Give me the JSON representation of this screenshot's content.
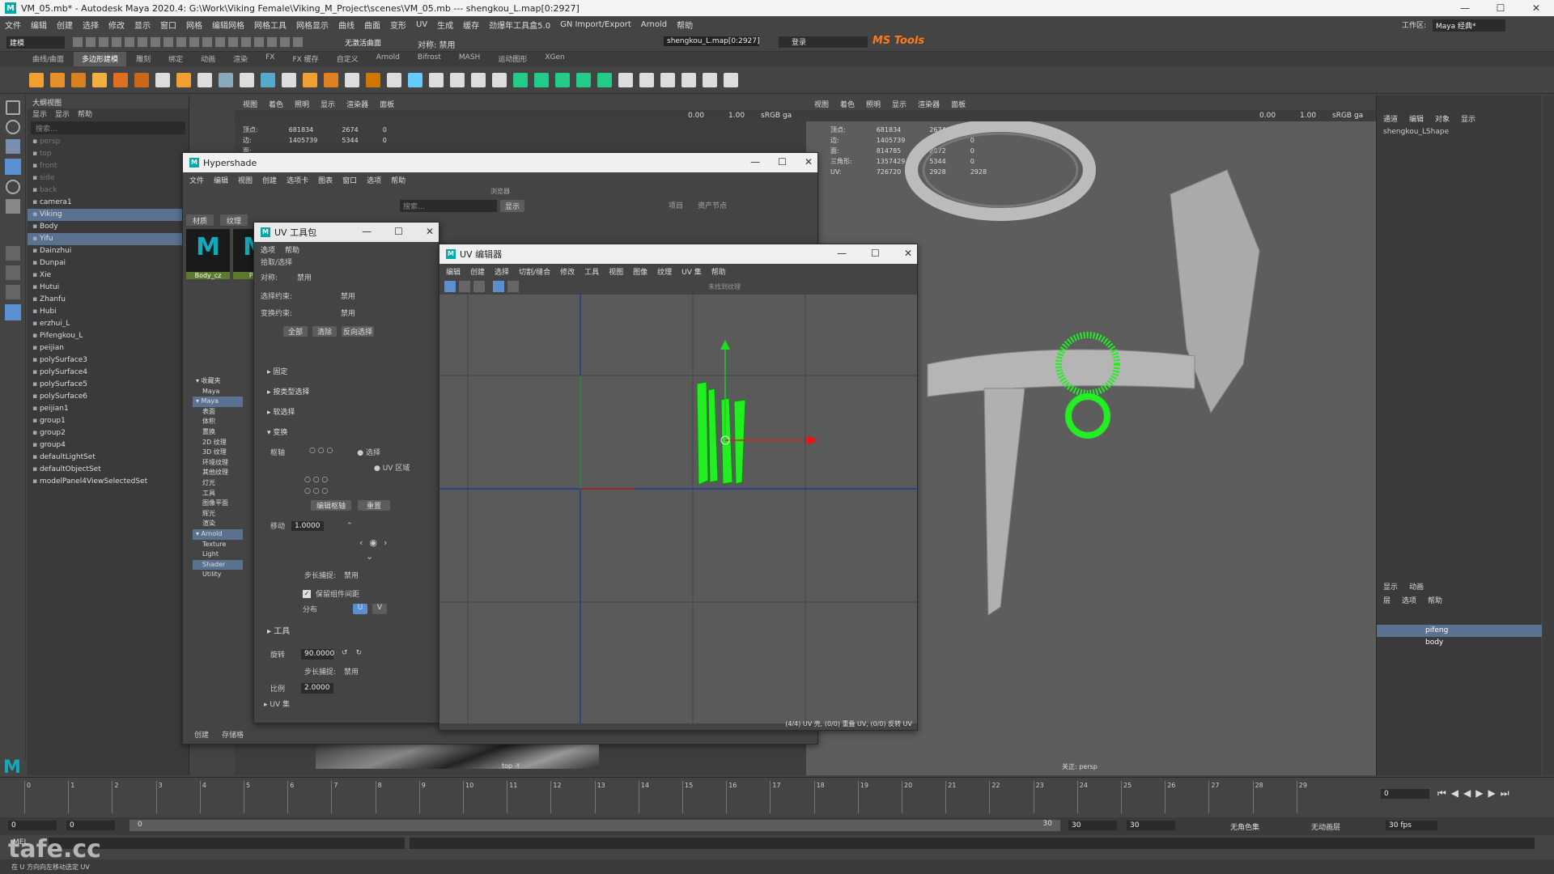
{
  "app": {
    "title": "VM_05.mb* - Autodesk Maya 2020.4: G:\\Work\\Viking Female\\Viking_M_Project\\scenes\\VM_05.mb  ---  shengkou_L.map[0:2927]",
    "workspace_label": "工作区:",
    "workspace_value": "Maya 经典*"
  },
  "menubar": [
    "文件",
    "编辑",
    "创建",
    "选择",
    "修改",
    "显示",
    "窗口",
    "网格",
    "编辑网格",
    "网格工具",
    "网格显示",
    "曲线",
    "曲面",
    "变形",
    "UV",
    "生成",
    "缓存",
    "劲爆年工具盒5.0",
    "GN Import/Export",
    "Arnold",
    "帮助"
  ],
  "toolbar": {
    "mode": "建模",
    "symmetry": "无激活曲面",
    "symmetry_label": "对称: 禁用",
    "selection_field": "shengkou_L.map[0:2927]",
    "login": "登录",
    "ms_tools": "MS Tools"
  },
  "shelf_tabs": [
    "曲线/曲面",
    "多边形建模",
    "雕刻",
    "绑定",
    "动画",
    "渲染",
    "FX",
    "FX 缓存",
    "自定义",
    "Arnold",
    "Bifrost",
    "MASH",
    "运动图形",
    "XGen"
  ],
  "shelf_active": "多边形建模",
  "outliner": {
    "panel_title": "大纲视图",
    "menu": [
      "显示",
      "显示",
      "帮助"
    ],
    "search_placeholder": "搜索...",
    "items": [
      {
        "label": "persp",
        "dim": true
      },
      {
        "label": "top",
        "dim": true
      },
      {
        "label": "front",
        "dim": true
      },
      {
        "label": "side",
        "dim": true
      },
      {
        "label": "back",
        "dim": true
      },
      {
        "label": "camera1",
        "dim": false
      },
      {
        "label": "Viking",
        "dim": false,
        "sel": true
      },
      {
        "label": "Body",
        "dim": false
      },
      {
        "label": "Yifu",
        "dim": false,
        "sel": true
      },
      {
        "label": "Dainzhui",
        "dim": false
      },
      {
        "label": "Dunpai",
        "dim": false
      },
      {
        "label": "Xie",
        "dim": false
      },
      {
        "label": "Hutui",
        "dim": false
      },
      {
        "label": "Zhanfu",
        "dim": false
      },
      {
        "label": "Hubi",
        "dim": false
      },
      {
        "label": "erzhui_L",
        "dim": false
      },
      {
        "label": "Pifengkou_L",
        "dim": false
      },
      {
        "label": "peijian",
        "dim": false
      },
      {
        "label": "polySurface3",
        "dim": false
      },
      {
        "label": "polySurface4",
        "dim": false
      },
      {
        "label": "polySurface5",
        "dim": false
      },
      {
        "label": "polySurface6",
        "dim": false
      },
      {
        "label": "peijian1",
        "dim": false
      },
      {
        "label": "group1",
        "dim": false
      },
      {
        "label": "group2",
        "dim": false
      },
      {
        "label": "group4",
        "dim": false
      },
      {
        "label": "defaultLightSet",
        "dim": false
      },
      {
        "label": "defaultObjectSet",
        "dim": false
      },
      {
        "label": "modelPanel4ViewSelectedSet",
        "dim": false
      }
    ]
  },
  "viewport_left": {
    "menu": [
      "视图",
      "着色",
      "照明",
      "显示",
      "渲染器",
      "面板"
    ],
    "hud_labels": [
      "顶点:",
      "边:",
      "面:",
      "三角形:",
      "UV:"
    ],
    "hud_col1": [
      "681834",
      "1405739",
      "",
      "",
      ""
    ],
    "hud_col2": [
      "2674",
      "5344",
      "",
      "",
      ""
    ],
    "hud_col3": [
      "0",
      "0",
      "",
      "",
      ""
    ],
    "cam_label": "top -Y",
    "field1": "0.00",
    "field2": "1.00",
    "colorspace": "sRGB ga"
  },
  "viewport_right": {
    "menu": [
      "视图",
      "着色",
      "照明",
      "显示",
      "渲染器",
      "面板"
    ],
    "hud_labels": [
      "顶点:",
      "边:",
      "面:",
      "三角形:",
      "UV:"
    ],
    "hud_col1": [
      "681834",
      "1405739",
      "814785",
      "1357429",
      "726720"
    ],
    "hud_col2": [
      "2674",
      "5344",
      "2672",
      "5344",
      "2928"
    ],
    "hud_col3": [
      "0",
      "0",
      "0",
      "0",
      "2928"
    ],
    "cam_label": "关正: persp",
    "field1": "0.00",
    "field2": "1.00",
    "colorspace": "sRGB ga"
  },
  "hypershade": {
    "title": "Hypershade",
    "menu": [
      "文件",
      "编辑",
      "视图",
      "创建",
      "选项卡",
      "图表",
      "窗口",
      "选项",
      "帮助"
    ],
    "browser_label": "浏览器",
    "search_placeholder": "搜索...",
    "show_btn": "显示",
    "tabs": [
      "材质",
      "纹理"
    ],
    "tabs_right": [
      "项目",
      "资产节点"
    ],
    "swatches": [
      "Body_cz",
      "Pife"
    ],
    "tree": [
      {
        "label": "收藏夹",
        "lvl": 0
      },
      {
        "label": "Maya",
        "lvl": 1
      },
      {
        "label": "Maya",
        "lvl": 0,
        "sel": true
      },
      {
        "label": "表面",
        "lvl": 1
      },
      {
        "label": "体积",
        "lvl": 1
      },
      {
        "label": "置换",
        "lvl": 1
      },
      {
        "label": "2D 纹理",
        "lvl": 1
      },
      {
        "label": "3D 纹理",
        "lvl": 1
      },
      {
        "label": "环境纹理",
        "lvl": 1
      },
      {
        "label": "其他纹理",
        "lvl": 1
      },
      {
        "label": "灯光",
        "lvl": 1
      },
      {
        "label": "工具",
        "lvl": 1
      },
      {
        "label": "图像平面",
        "lvl": 1
      },
      {
        "label": "辉光",
        "lvl": 1
      },
      {
        "label": "渲染",
        "lvl": 1
      },
      {
        "label": "Arnold",
        "lvl": 0,
        "sel": true
      },
      {
        "label": "Texture",
        "lvl": 1
      },
      {
        "label": "Light",
        "lvl": 1
      },
      {
        "label": "Shader",
        "lvl": 1,
        "sel": true
      },
      {
        "label": "Utility",
        "lvl": 1
      }
    ],
    "bottom_tabs": [
      "创建",
      "存储格"
    ]
  },
  "uvtoolkit": {
    "title": "UV 工具包",
    "menu": [
      "选项",
      "帮助"
    ],
    "section_pick": "拾取/选择",
    "sym_label": "对称:",
    "sym_value": "禁用",
    "sel_constraint_label": "选择约束:",
    "sel_constraint_value": "禁用",
    "trans_constraint_label": "变换约束:",
    "trans_constraint_value": "禁用",
    "btn_all": "全部",
    "btn_clear": "清除",
    "btn_invert": "反向选择",
    "sections": [
      "固定",
      "按类型选择",
      "软选择",
      "变换"
    ],
    "pivot_label": "枢轴",
    "opt_selection": "选择",
    "opt_uvrange": "UV 区域",
    "btn_edit_pivot": "编辑枢轴",
    "btn_reset": "重置",
    "move_label": "移动",
    "move_value": "1.0000",
    "snap_label": "步长捕捉:",
    "snap_value": "禁用",
    "keep_label": "保留组件间距",
    "distribute_label": "分布",
    "u_label": "U",
    "v_label": "V",
    "tools_label": "工具",
    "rotate_label": "旋转",
    "rotate_value": "90.0000",
    "snap2_label": "步长捕捉:",
    "snap2_value": "禁用",
    "scale_label": "比例",
    "scale_value": "2.0000",
    "uvset_label": "UV 集"
  },
  "uveditor": {
    "title": "UV 编辑器",
    "menu": [
      "编辑",
      "创建",
      "选择",
      "切割/缝合",
      "修改",
      "工具",
      "视图",
      "图像",
      "纹理",
      "UV 集",
      "帮助"
    ],
    "tex_label": "未找到纹理",
    "status": "(4/4) UV 壳, (0/0) 重叠 UV, (0/0) 反转 UV"
  },
  "right_panel": {
    "menu": [
      "通道",
      "编辑",
      "对象",
      "显示"
    ],
    "object_name": "shengkou_LShape",
    "layer_tabs": [
      "显示",
      "动画"
    ],
    "layer_menu": [
      "层",
      "选项",
      "帮助"
    ],
    "layers": [
      {
        "label": "pifeng",
        "sel": true
      },
      {
        "label": "body",
        "sel": false
      }
    ]
  },
  "timeline": {
    "ticks": [
      "0",
      "1",
      "2",
      "3",
      "4",
      "5",
      "6",
      "7",
      "8",
      "9",
      "10",
      "11",
      "12",
      "13",
      "14",
      "15",
      "16",
      "17",
      "18",
      "19",
      "20",
      "21",
      "22",
      "23",
      "24",
      "25",
      "26",
      "27",
      "28",
      "29"
    ],
    "current_frame": "0",
    "range_start": "0",
    "range_start2": "0",
    "range_inner": "0",
    "range_end_a": "30",
    "range_end_b": "30",
    "range_end_c": "30",
    "char_set": "无角色集",
    "anim_layer": "无动画层",
    "fps": "30 fps"
  },
  "cmd": {
    "label": "MEL"
  },
  "help_line": "在 U 方向向左移动选定 UV",
  "watermark": "tafe.cc",
  "colors": {
    "uv_green": "#22ee22",
    "accent_blue": "#5a7290",
    "ms_orange": "#ff7a1a"
  }
}
